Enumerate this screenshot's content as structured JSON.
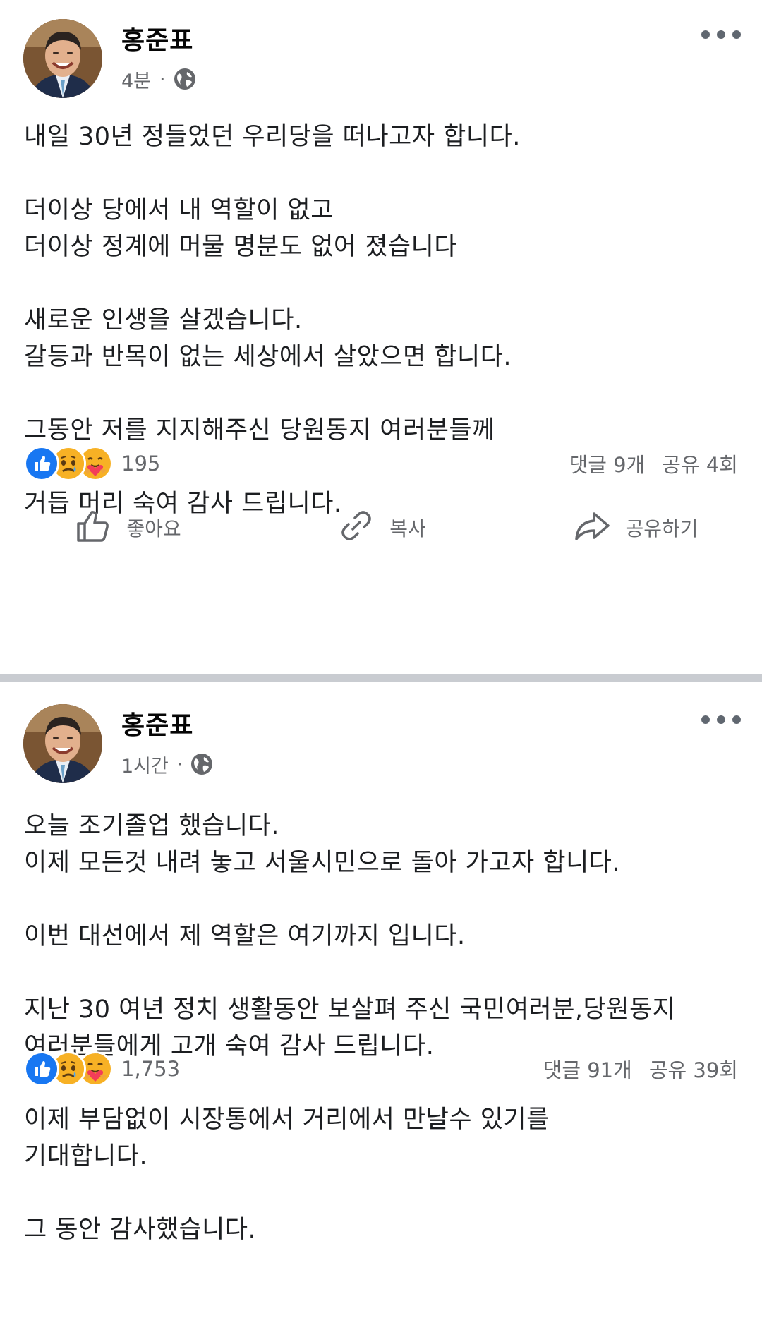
{
  "posts": [
    {
      "author": "홍준표",
      "time": "4분",
      "body": "내일 30년 정들었던 우리당을 떠나고자 합니다.\n\n더이상 당에서 내 역할이 없고\n더이상 정계에 머물 명분도 없어 졌습니다\n\n새로운 인생을 살겠습니다.\n갈등과 반목이 없는 세상에서 살았으면 합니다.\n\n그동안 저를 지지해주신 당원동지 여러분들께\n\n거듭 머리 숙여 감사 드립니다.",
      "reaction_count": "195",
      "comments": "댓글 9개",
      "shares": "공유 4회",
      "actions": {
        "like": "좋아요",
        "copy": "복사",
        "share": "공유하기"
      }
    },
    {
      "author": "홍준표",
      "time": "1시간",
      "body": "오늘 조기졸업 했습니다.\n이제 모든것 내려 놓고 서울시민으로 돌아 가고자 합니다.\n\n이번 대선에서 제 역할은 여기까지 입니다.\n\n지난 30 여년 정치 생활동안 보살펴 주신 국민여러분,당원동지\n여러분들에게 고개 숙여 감사 드립니다.\n\n이제 부담없이 시장통에서 거리에서 만날수 있기를\n기대합니다.\n\n그 동안 감사했습니다.",
      "reaction_count": "1,753",
      "comments": "댓글 91개",
      "shares": "공유 39회"
    }
  ],
  "separator": "·",
  "icons": {
    "reactions": [
      "like-icon",
      "sad-icon",
      "care-icon"
    ],
    "meta": "globe-icon",
    "more": "more-options-icon"
  },
  "colors": {
    "like_blue": "#1877f2",
    "reaction_yellow": "#f7b125",
    "care_red": "#f33e58",
    "secondary_text": "#65676b",
    "divider": "#c9ccd1"
  }
}
